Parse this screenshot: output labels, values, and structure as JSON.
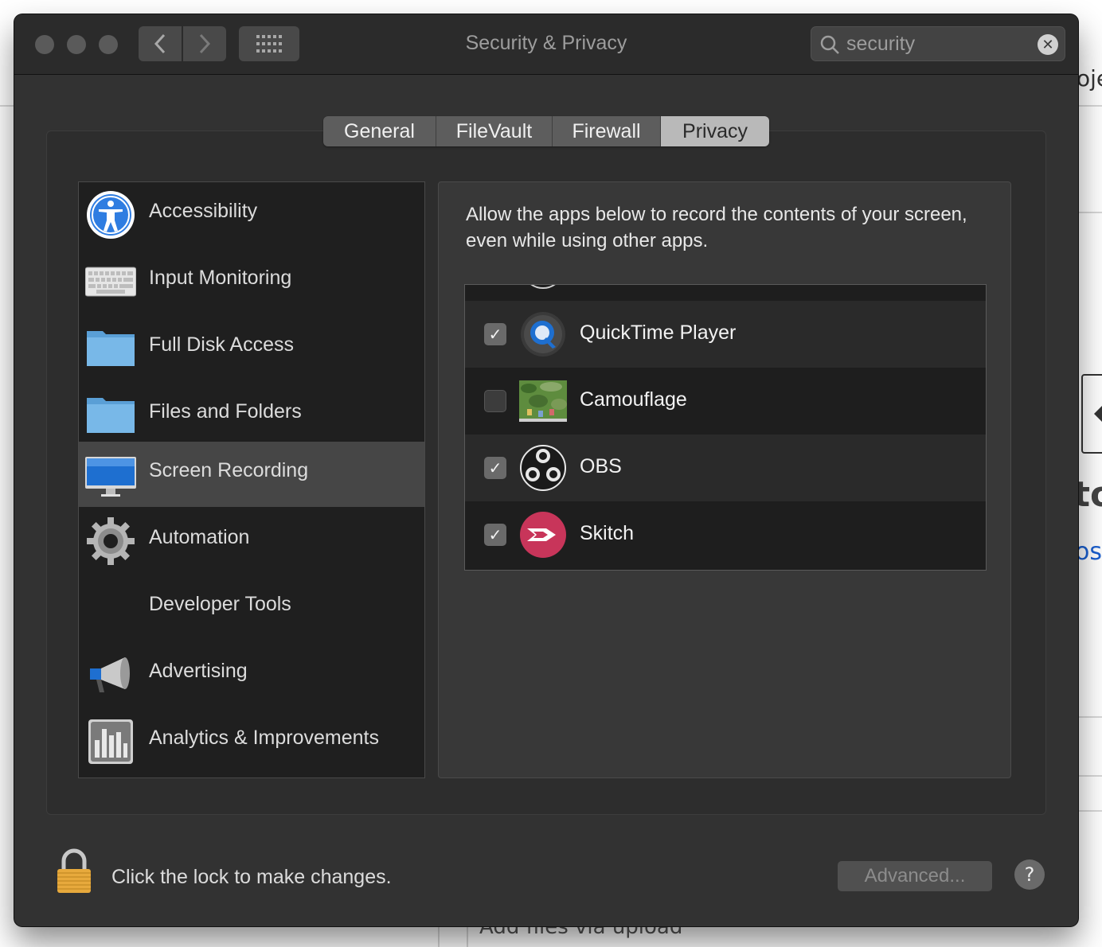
{
  "window": {
    "title": "Security & Privacy"
  },
  "search": {
    "value": "security"
  },
  "tabs": [
    {
      "label": "General"
    },
    {
      "label": "FileVault"
    },
    {
      "label": "Firewall"
    },
    {
      "label": "Privacy",
      "active": true
    }
  ],
  "sidebar": {
    "items": [
      {
        "label": "Accessibility",
        "icon": "accessibility-icon"
      },
      {
        "label": "Input Monitoring",
        "icon": "keyboard-icon"
      },
      {
        "label": "Full Disk Access",
        "icon": "folder-icon"
      },
      {
        "label": "Files and Folders",
        "icon": "folder-icon"
      },
      {
        "label": "Screen Recording",
        "icon": "monitor-icon",
        "selected": true
      },
      {
        "label": "Automation",
        "icon": "gear-icon"
      },
      {
        "label": "Developer Tools",
        "icon": ""
      },
      {
        "label": "Advertising",
        "icon": "megaphone-icon"
      },
      {
        "label": "Analytics & Improvements",
        "icon": "bar-chart-icon"
      }
    ]
  },
  "content": {
    "description": "Allow the apps below to record the contents of your screen, even while using other apps.",
    "apps": [
      {
        "name": "QuickTime Player",
        "checked": true,
        "icon": "quicktime-icon"
      },
      {
        "name": "Camouflage",
        "checked": false,
        "icon": "camouflage-icon"
      },
      {
        "name": "OBS",
        "checked": true,
        "icon": "obs-icon"
      },
      {
        "name": "Skitch",
        "checked": true,
        "icon": "skitch-icon"
      }
    ]
  },
  "footer": {
    "lock_text": "Click the lock to make changes.",
    "advanced_label": "Advanced...",
    "help_label": "?"
  },
  "background": {
    "partial_text_1": "oje",
    "partial_text_2": "to",
    "partial_text_3": "os",
    "partial_text_4": "Add files via upload"
  },
  "colors": {
    "window_bg": "#323232",
    "selected_row": "#464646",
    "link_blue": "#1a5fd0"
  }
}
